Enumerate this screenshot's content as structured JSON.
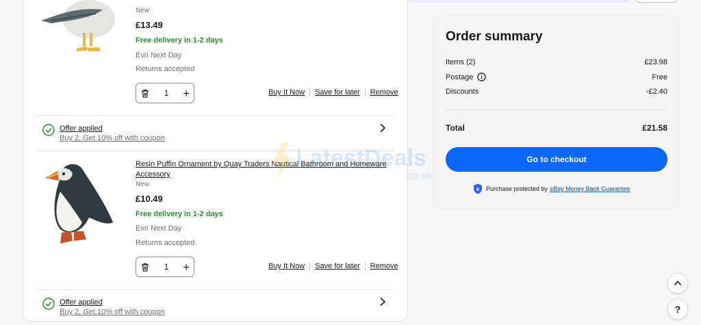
{
  "items": [
    {
      "condition": "New",
      "price": "£13.49",
      "delivery": "Free delivery in 1-2 days",
      "carrier": "Evri Next Day",
      "returns": "Returns accepted",
      "quantity": "1",
      "actions": {
        "buy": "Buy It Now",
        "save": "Save for later",
        "remove": "Remove"
      },
      "offer": {
        "title": "Offer applied",
        "detail": "Buy 2, Get 10% off with coupon"
      }
    },
    {
      "title": "Resin Puffin Ornament by Quay Traders Nautical Bathroom and Homeware Accessory",
      "condition": "New",
      "price": "£10.49",
      "delivery": "Free delivery in 1-2 days",
      "carrier": "Evri Next Day",
      "returns": "Returns accepted",
      "quantity": "1",
      "actions": {
        "buy": "Buy It Now",
        "save": "Save for later",
        "remove": "Remove"
      },
      "offer": {
        "title": "Offer applied",
        "detail": "Buy 2, Get 10% off with coupon"
      }
    }
  ],
  "summary": {
    "heading": "Order summary",
    "items_label": "Items (2)",
    "items_value": "£23.98",
    "postage_label": "Postage",
    "postage_value": "Free",
    "discounts_label": "Discounts",
    "discounts_value": "-£2.40",
    "total_label": "Total",
    "total_value": "£21.58",
    "checkout_label": "Go to checkout",
    "protect_text": "Purchase protected by",
    "protect_link": "eBay Money Back Guarantee"
  },
  "colors": {
    "accent": "#0968f6",
    "green": "#2e8b2e",
    "link": "#0654ba"
  },
  "watermark": {
    "brand": "LatestDeals",
    "tld": ".co.uk"
  }
}
